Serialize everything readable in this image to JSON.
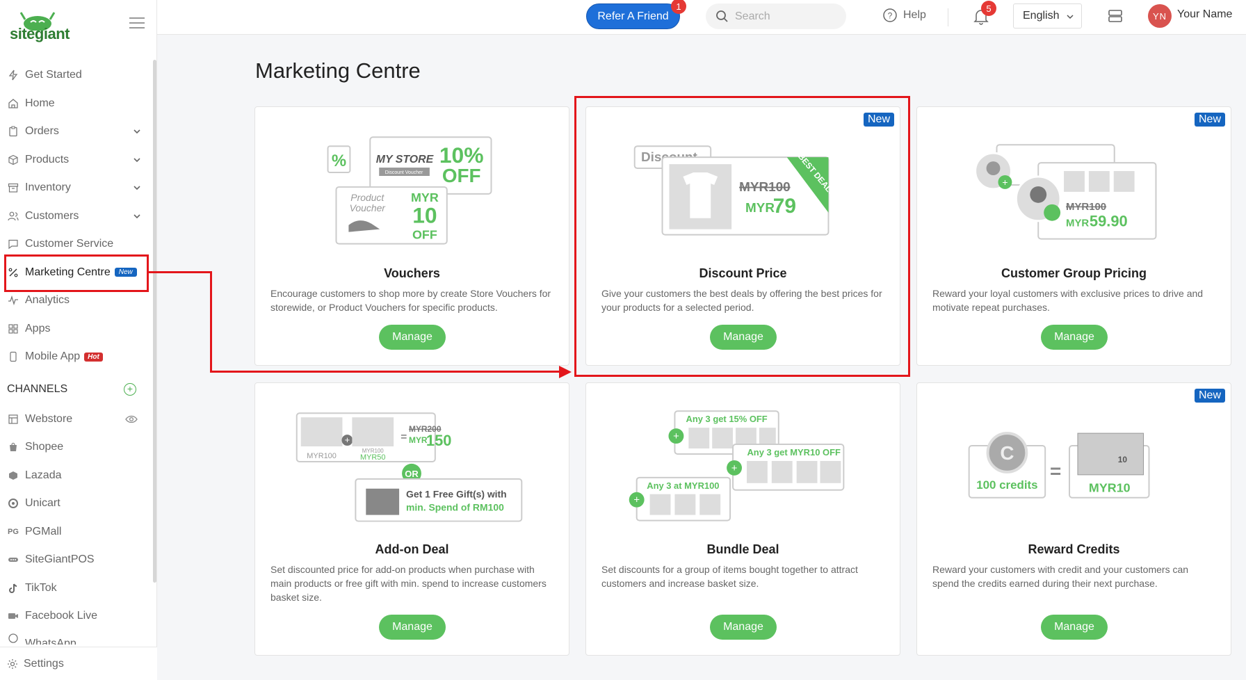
{
  "brand": {
    "logo_text": "sitegiant"
  },
  "topbar": {
    "refer_label": "Refer A Friend",
    "refer_badge": "1",
    "search_placeholder": "Search",
    "help_label": "Help",
    "notification_count": "5",
    "language": "English",
    "avatar_initials": "YN",
    "user_name": "Your Name"
  },
  "sidebar": {
    "items": [
      {
        "label": "Get Started",
        "icon": "bolt-icon"
      },
      {
        "label": "Home",
        "icon": "home-icon"
      },
      {
        "label": "Orders",
        "icon": "clipboard-icon"
      },
      {
        "label": "Products",
        "icon": "box-icon"
      },
      {
        "label": "Inventory",
        "icon": "archive-icon"
      },
      {
        "label": "Customers",
        "icon": "users-icon"
      },
      {
        "label": "Customer Service",
        "icon": "chat-icon"
      },
      {
        "label": "Marketing Centre",
        "icon": "percent-icon",
        "badge": "New"
      },
      {
        "label": "Analytics",
        "icon": "pulse-icon"
      },
      {
        "label": "Apps",
        "icon": "apps-icon"
      },
      {
        "label": "Mobile App",
        "icon": "phone-icon",
        "badge": "Hot"
      }
    ],
    "channels_heading": "CHANNELS",
    "channels": [
      {
        "label": "Webstore",
        "icon": "store-icon"
      },
      {
        "label": "Shopee",
        "icon": "shopee-icon"
      },
      {
        "label": "Lazada",
        "icon": "lazada-icon"
      },
      {
        "label": "Unicart",
        "icon": "unicart-icon"
      },
      {
        "label": "PGMall",
        "icon": "pgmall-icon"
      },
      {
        "label": "SiteGiantPOS",
        "icon": "pos-icon"
      },
      {
        "label": "TikTok",
        "icon": "tiktok-icon"
      },
      {
        "label": "Facebook Live",
        "icon": "video-icon"
      },
      {
        "label": "WhatsApp",
        "icon": "whatsapp-icon"
      }
    ],
    "settings_label": "Settings"
  },
  "main": {
    "title": "Marketing Centre",
    "cards": [
      {
        "title": "Vouchers",
        "desc": "Encourage customers to shop more by create Store Vouchers for storewide, or Product Vouchers for specific products.",
        "button": "Manage",
        "illus": {
          "store": "MY STORE",
          "store_sub": "Discount Voucher",
          "pct": "10%",
          "off": "OFF",
          "product": "Product",
          "voucher": "Voucher",
          "myr": "MYR",
          "amt": "10",
          "off2": "OFF"
        }
      },
      {
        "title": "Discount Price",
        "desc": "Give your customers the best deals by offering the best prices for your products for a selected period.",
        "button": "Manage",
        "tag": "New",
        "illus": {
          "label": "Discount",
          "old": "MYR100",
          "cur": "MYR",
          "new": "79",
          "ribbon": "BEST DEALS"
        }
      },
      {
        "title": "Customer Group Pricing",
        "desc": "Reward your loyal customers with exclusive prices to drive and motivate repeat purchases.",
        "button": "Manage",
        "tag": "New",
        "illus": {
          "old": "MYR100",
          "cur": "MYR",
          "new": "59.90"
        }
      },
      {
        "title": "Add-on Deal",
        "desc": "Set discounted price for add-on products when purchase with main products or free gift with min. spend to increase customers basket size.",
        "button": "Manage",
        "illus": {
          "p1": "MYR100",
          "p2old": "MYR100",
          "p2new": "MYR50",
          "totold": "MYR200",
          "totcur": "MYR",
          "totnew": "150",
          "or": "OR",
          "gift1": "Get 1 Free Gift(s) with",
          "gift2": "min. Spend of RM100"
        }
      },
      {
        "title": "Bundle Deal",
        "desc": "Set discounts for a group of items bought together to attract customers and increase basket size.",
        "button": "Manage",
        "illus": {
          "d1": "Any 3 get 15% OFF",
          "d2": "Any 3 get MYR10 OFF",
          "d3": "Any 3 at MYR100"
        }
      },
      {
        "title": "Reward Credits",
        "desc": "Reward your customers with credit and your customers can spend the credits earned during their next purchase.",
        "button": "Manage",
        "tag": "New",
        "illus": {
          "credits": "100 credits",
          "eq": "=",
          "myr": "MYR10",
          "note": "10"
        }
      }
    ]
  },
  "colors": {
    "accent": "#5cc15f",
    "brand_blue": "#1e6fd9",
    "tag_blue": "#1565c0",
    "annotation": "#e3161b"
  }
}
